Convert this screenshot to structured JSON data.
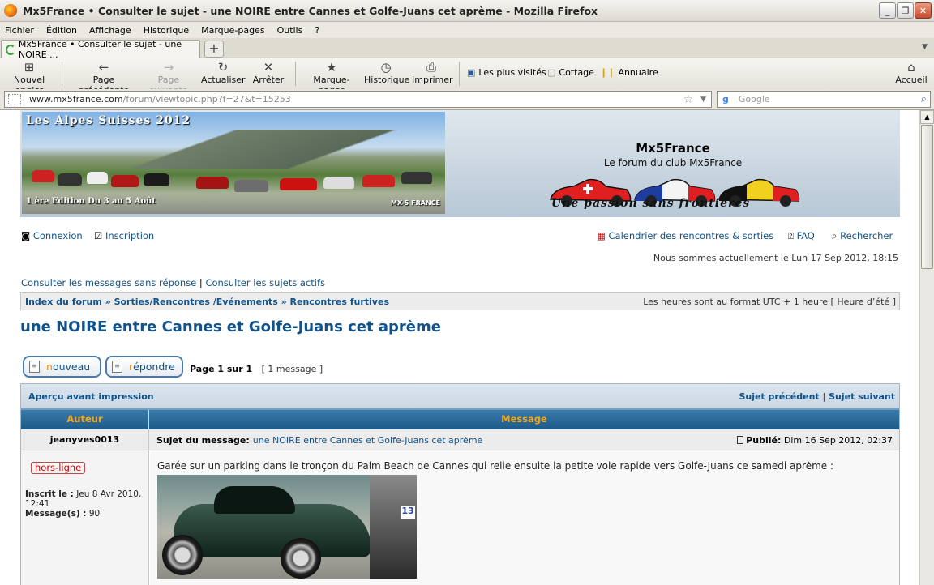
{
  "window": {
    "title": "Mx5France • Consulter le sujet - une NOIRE entre Cannes et Golfe-Juans cet aprème - Mozilla Firefox",
    "minimize": "_",
    "maximize": "❐",
    "close": "✕"
  },
  "menu": [
    "Fichier",
    "Édition",
    "Affichage",
    "Historique",
    "Marque-pages",
    "Outils",
    "?"
  ],
  "tab": {
    "label": "Mx5France • Consulter le sujet - une NOIRE ...",
    "new_tab": "+"
  },
  "toolbar": {
    "new_tab": "Nouvel onglet",
    "back": "Page précédente",
    "forward": "Page suivante",
    "reload": "Actualiser",
    "stop": "Arrêter",
    "bookmarks": "Marque-pages",
    "history": "Historique",
    "print": "Imprimer",
    "home": "Accueil"
  },
  "bookmarks_bar": [
    "Les plus visités",
    "Cottage",
    "Annuaire"
  ],
  "address": {
    "url_host": "www.mx5france.com",
    "url_path": "/forum/viewtopic.php?f=27&t=15253",
    "search_placeholder": "Google",
    "search_engine": "g"
  },
  "banner": {
    "title": "Les Alpes Suisses 2012",
    "subtitle": "1 ère Edition Du 3 au 5 Août",
    "logo_text": "MX-5 FRANCE"
  },
  "site": {
    "title": "Mx5France",
    "description": "Le forum du club Mx5France",
    "slogan": "Une passion sans frontières"
  },
  "toplinks": {
    "login": "Connexion",
    "register": "Inscription",
    "calendar": "Calendrier des rencontres & sorties",
    "faq": "FAQ",
    "search": "Rechercher"
  },
  "date_text": "Nous sommes actuellement le Lun 17 Sep 2012, 18:15",
  "view_links": {
    "unanswered": "Consulter les messages sans réponse",
    "separator": "|",
    "active": "Consulter les sujets actifs"
  },
  "breadcrumb": {
    "index": "Index du forum",
    "sep": "»",
    "cat": "Sorties/Rencontres /Evénements",
    "forum": "Rencontres furtives",
    "timezone": "Les heures sont au format UTC + 1 heure [ Heure d’été ]"
  },
  "topic": {
    "title": "une NOIRE entre Cannes et Golfe-Juans cet aprème",
    "btn_new_first": "n",
    "btn_new_rest": "ouveau",
    "btn_reply_first": "r",
    "btn_reply_rest": "épondre",
    "page_info": "Page 1 sur 1",
    "message_count": "[ 1 message ]"
  },
  "table": {
    "print_preview": "Aperçu avant impression",
    "prev_topic": "Sujet précédent",
    "sep": "|",
    "next_topic": "Sujet suivant",
    "col_author": "Auteur",
    "col_message": "Message"
  },
  "post": {
    "author": "jeanyves0013",
    "subject_label": "Sujet du message:",
    "subject": "une NOIRE entre Cannes et Golfe-Juans cet aprème",
    "posted_label": "Publié:",
    "posted_date": "Dim 16 Sep 2012, 02:37",
    "status": "hors-ligne",
    "joined_label": "Inscrit le :",
    "joined_value": "Jeu 8 Avr 2010, 12:41",
    "messages_label": "Message(s) :",
    "messages_value": "90",
    "body": "Garée sur un parking dans le tronçon du Palm Beach de Cannes qui relie ensuite la petite voie rapide vers Golfe-Juans ce samedi aprème :",
    "photo_number": "13"
  }
}
